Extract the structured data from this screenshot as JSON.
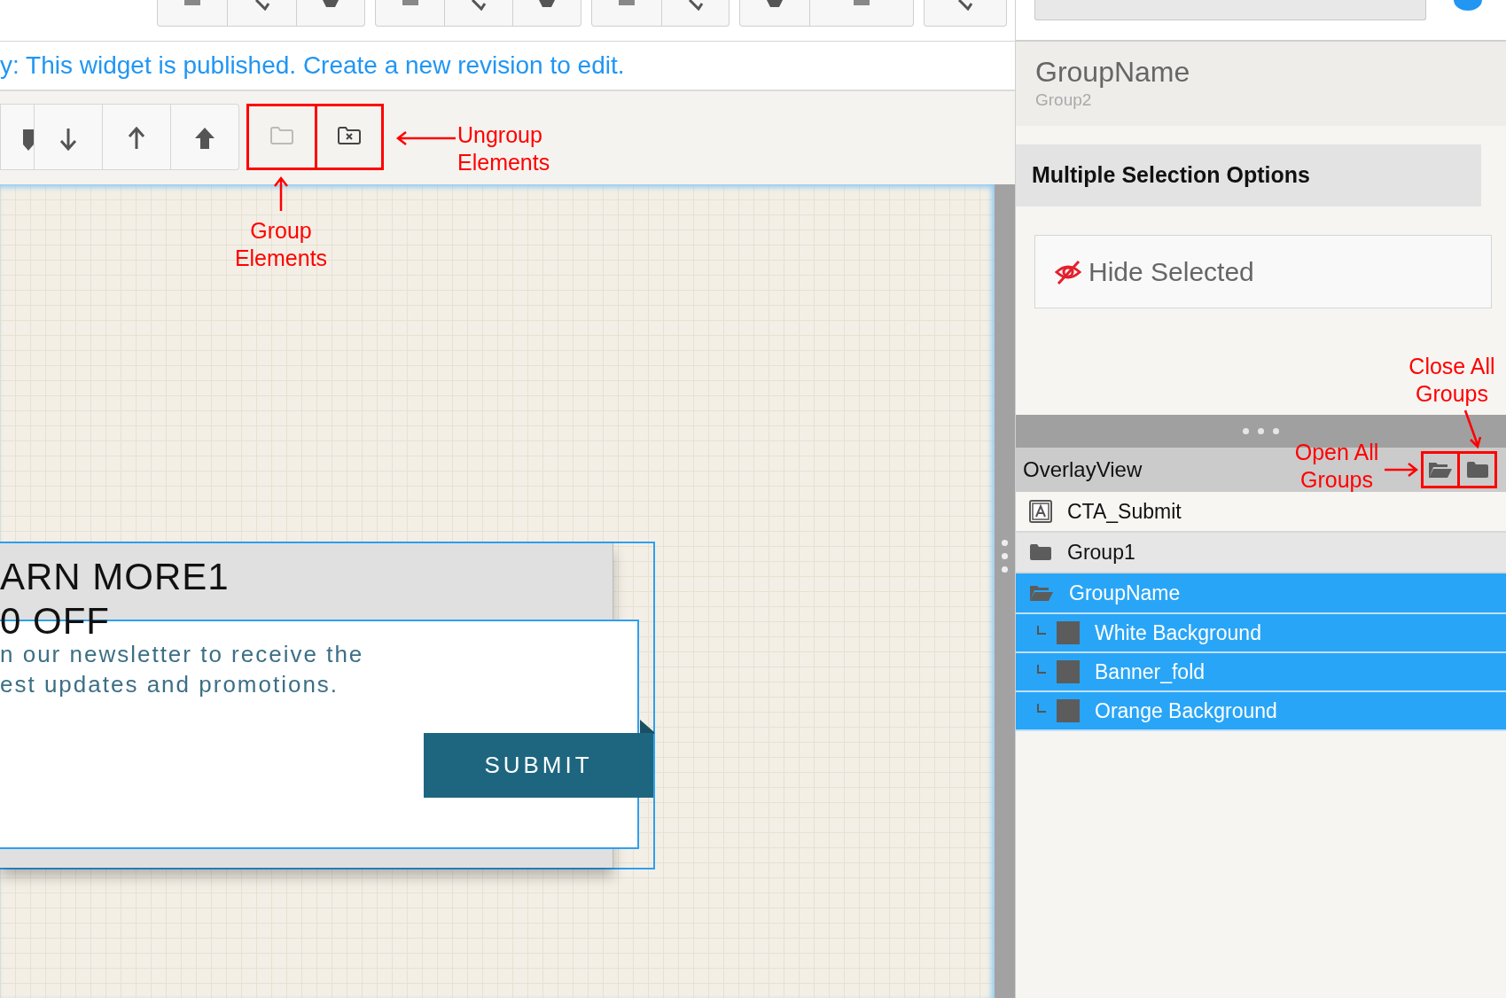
{
  "notice": "y: This widget is published. Create a new revision to edit.",
  "arrange_tools": [
    {
      "kind": "backward-more"
    },
    {
      "kind": "backward"
    },
    {
      "kind": "forward"
    },
    {
      "kind": "front"
    },
    {
      "kind": "group",
      "disabled": true,
      "highlighted": true
    },
    {
      "kind": "ungroup",
      "disabled": false,
      "highlighted": true
    }
  ],
  "annotations": [
    {
      "text": "Ungroup Elements"
    },
    {
      "text": "Group Elements"
    },
    {
      "text": "Close All Groups"
    },
    {
      "text": "Open All Groups"
    }
  ],
  "widget": {
    "heading_lines": [
      "ARN MORE1",
      "0 OFF"
    ],
    "body_lines": [
      "n our newsletter to receive the",
      "est updates and promotions."
    ],
    "button": "SUBMIT"
  },
  "properties": {
    "title": "GroupName",
    "subtitle": "Group2",
    "section": "Multiple Selection Options",
    "hide_button": "Hide Selected"
  },
  "layers": {
    "title": "OverlayView",
    "items": [
      {
        "label": "CTA_Submit",
        "kind": "text",
        "selected": false
      },
      {
        "label": "Group1",
        "kind": "group",
        "expanded": false,
        "selected": false
      },
      {
        "label": "GroupName",
        "kind": "group",
        "expanded": true,
        "selected": true,
        "children": [
          {
            "label": "White Background",
            "kind": "shape",
            "selected": true
          },
          {
            "label": "Banner_fold",
            "kind": "shape",
            "selected": true
          },
          {
            "label": "Orange Background",
            "kind": "shape",
            "selected": true
          }
        ]
      }
    ]
  }
}
